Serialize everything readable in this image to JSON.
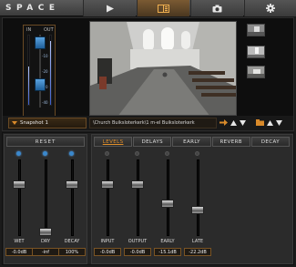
{
  "app": {
    "title": "SPACE"
  },
  "tabs": [
    {
      "name": "play",
      "icon": "play-icon"
    },
    {
      "name": "panels",
      "icon": "panel-view-icon",
      "active": true
    },
    {
      "name": "camera",
      "icon": "camera-icon"
    },
    {
      "name": "settings",
      "icon": "gear-icon"
    }
  ],
  "mix": {
    "in_label": "IN",
    "out_label": "OUT",
    "in_level": 0.55,
    "out_level": 0.92,
    "value_labels": [
      "0",
      "-10",
      "-20",
      "-30",
      "-40"
    ],
    "accent_color": "#3a88cc"
  },
  "snapshot": {
    "selected": "Snapshot 1"
  },
  "impulse": {
    "path": "\\Church Buiksloterkerk\\1 m-el Buiksloterkerk"
  },
  "left_panel": {
    "reset_label": "RESET",
    "faders": [
      {
        "name": "WET",
        "value": "-0.0dB",
        "level": 0.7,
        "led": true
      },
      {
        "name": "DRY",
        "value": "-inf",
        "level": 0.0,
        "led": true
      },
      {
        "name": "DECAY",
        "value": "100%",
        "level": 0.7,
        "led": true
      }
    ]
  },
  "right_panel": {
    "tabs": [
      "LEVELS",
      "DELAYS",
      "EARLY",
      "REVERB",
      "DECAY"
    ],
    "active_tab": "LEVELS",
    "faders": [
      {
        "name": "INPUT",
        "value": "-0.0dB",
        "level": 0.7,
        "led": false
      },
      {
        "name": "OUTPUT",
        "value": "-0.0dB",
        "level": 0.7,
        "led": false
      },
      {
        "name": "EARLY",
        "value": "-15.1dB",
        "level": 0.42,
        "led": false
      },
      {
        "name": "LATE",
        "value": "-22.2dB",
        "level": 0.32,
        "led": false
      }
    ]
  },
  "colors": {
    "accent": "#e08f2b",
    "frame": "#6a4a24"
  }
}
